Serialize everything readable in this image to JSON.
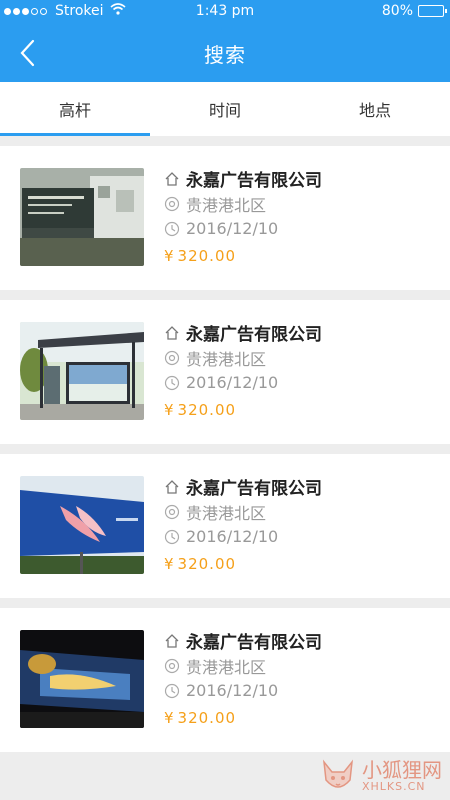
{
  "status_bar": {
    "carrier": "Strokei",
    "time": "1:43 pm",
    "battery": "80%",
    "battery_level": 0.8
  },
  "nav": {
    "title": "搜索"
  },
  "tabs": [
    {
      "label": "高杆",
      "active": true
    },
    {
      "label": "时间",
      "active": false
    },
    {
      "label": "地点",
      "active": false
    }
  ],
  "listings": [
    {
      "company": "永嘉广告有限公司",
      "location": "贵港港北区",
      "date": "2016/12/10",
      "currency": "¥",
      "price": "320.00",
      "image": "building-billboard"
    },
    {
      "company": "永嘉广告有限公司",
      "location": "贵港港北区",
      "date": "2016/12/10",
      "currency": "¥",
      "price": "320.00",
      "image": "bus-stop-billboard"
    },
    {
      "company": "永嘉广告有限公司",
      "location": "贵港港北区",
      "date": "2016/12/10",
      "currency": "¥",
      "price": "320.00",
      "image": "highway-billboard"
    },
    {
      "company": "永嘉广告有限公司",
      "location": "贵港港北区",
      "date": "2016/12/10",
      "currency": "¥",
      "price": "320.00",
      "image": "night-billboard"
    }
  ],
  "watermark": {
    "cn": "小狐狸网",
    "en": "XHLKS.CN"
  },
  "colors": {
    "primary": "#2b9df0",
    "price": "#f5a01a",
    "background": "#ededed"
  }
}
